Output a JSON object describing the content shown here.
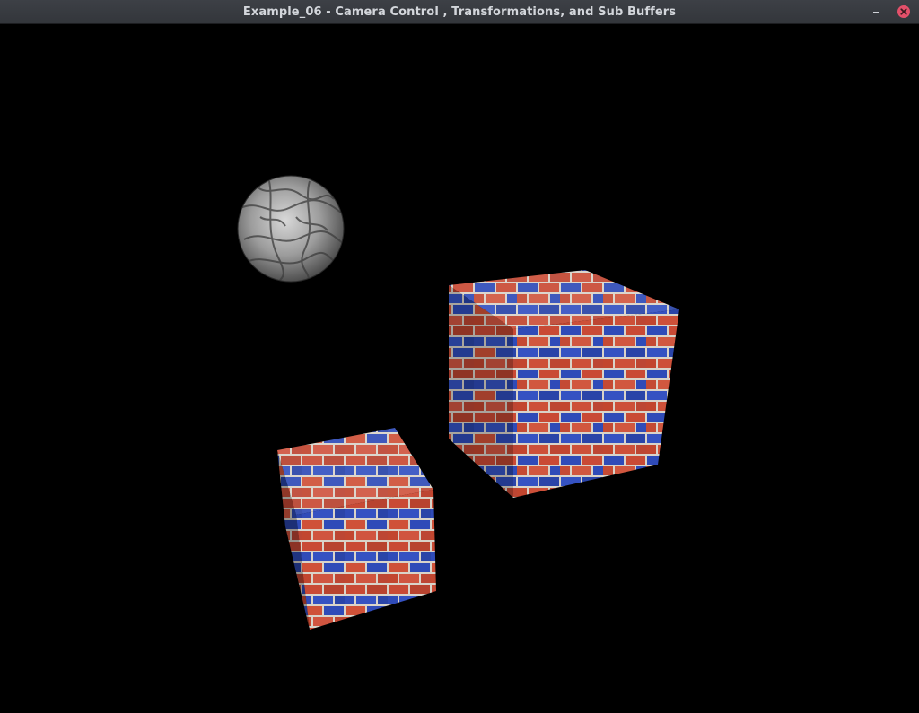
{
  "window": {
    "title": "Example_06 - Camera Control , Transformations, and Sub Buffers",
    "controls": {
      "minimize_icon": "minimize-icon",
      "close_icon": "close-icon",
      "close_color": "#e3506a"
    }
  },
  "scene": {
    "background": "#000000",
    "objects": [
      {
        "name": "marble-sphere",
        "kind": "sphere",
        "texture": "grey marble"
      },
      {
        "name": "brick-cube-large",
        "kind": "cube",
        "texture": "red and blue bricks"
      },
      {
        "name": "brick-cube-small",
        "kind": "cube",
        "texture": "red and blue bricks"
      }
    ],
    "colors": {
      "brick_red": "#c94a35",
      "brick_blue": "#2f4bb8",
      "mortar": "#d8d2c8",
      "marble": "#9a9a9a"
    }
  }
}
